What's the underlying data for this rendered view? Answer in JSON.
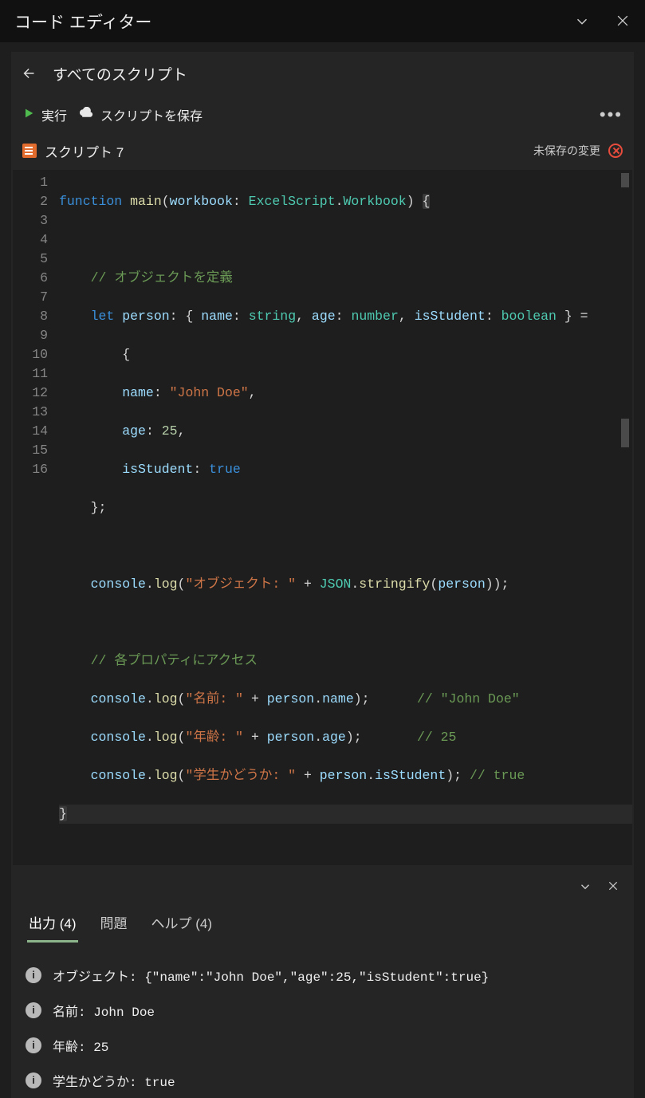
{
  "header": {
    "title": "コード エディター"
  },
  "sub": {
    "title": "すべてのスクリプト"
  },
  "toolbar": {
    "run": "実行",
    "save": "スクリプトを保存"
  },
  "script": {
    "name": "スクリプト 7",
    "unsaved": "未保存の変更"
  },
  "code": {
    "lines": 16,
    "fn_kw": "function",
    "main": "main",
    "param": "workbook",
    "ns": "ExcelScript",
    "wb": "Workbook",
    "c_obj": "// オブジェクトを定義",
    "let_kw": "let",
    "person": "person",
    "name": "name",
    "string": "string",
    "age": "age",
    "number": "number",
    "isStudent": "isStudent",
    "boolean": "boolean",
    "john": "\"John Doe\"",
    "n25": "25",
    "true": "true",
    "console": "console",
    "log": "log",
    "json": "JSON",
    "stringify": "stringify",
    "s_obj": "\"オブジェクト: \"",
    "c_props": "// 各プロパティにアクセス",
    "s_name": "\"名前: \"",
    "c_john": "// \"John Doe\"",
    "s_age": "\"年齢: \"",
    "c_25": "// 25",
    "s_stud": "\"学生かどうか: \"",
    "c_true": "// true"
  },
  "tabs": {
    "output": "出力 (4)",
    "problems": "問題",
    "help": "ヘルプ (4)"
  },
  "output": [
    "オブジェクト: {\"name\":\"John Doe\",\"age\":25,\"isStudent\":true}",
    "名前: John Doe",
    "年齢: 25",
    "学生かどうか: true"
  ]
}
